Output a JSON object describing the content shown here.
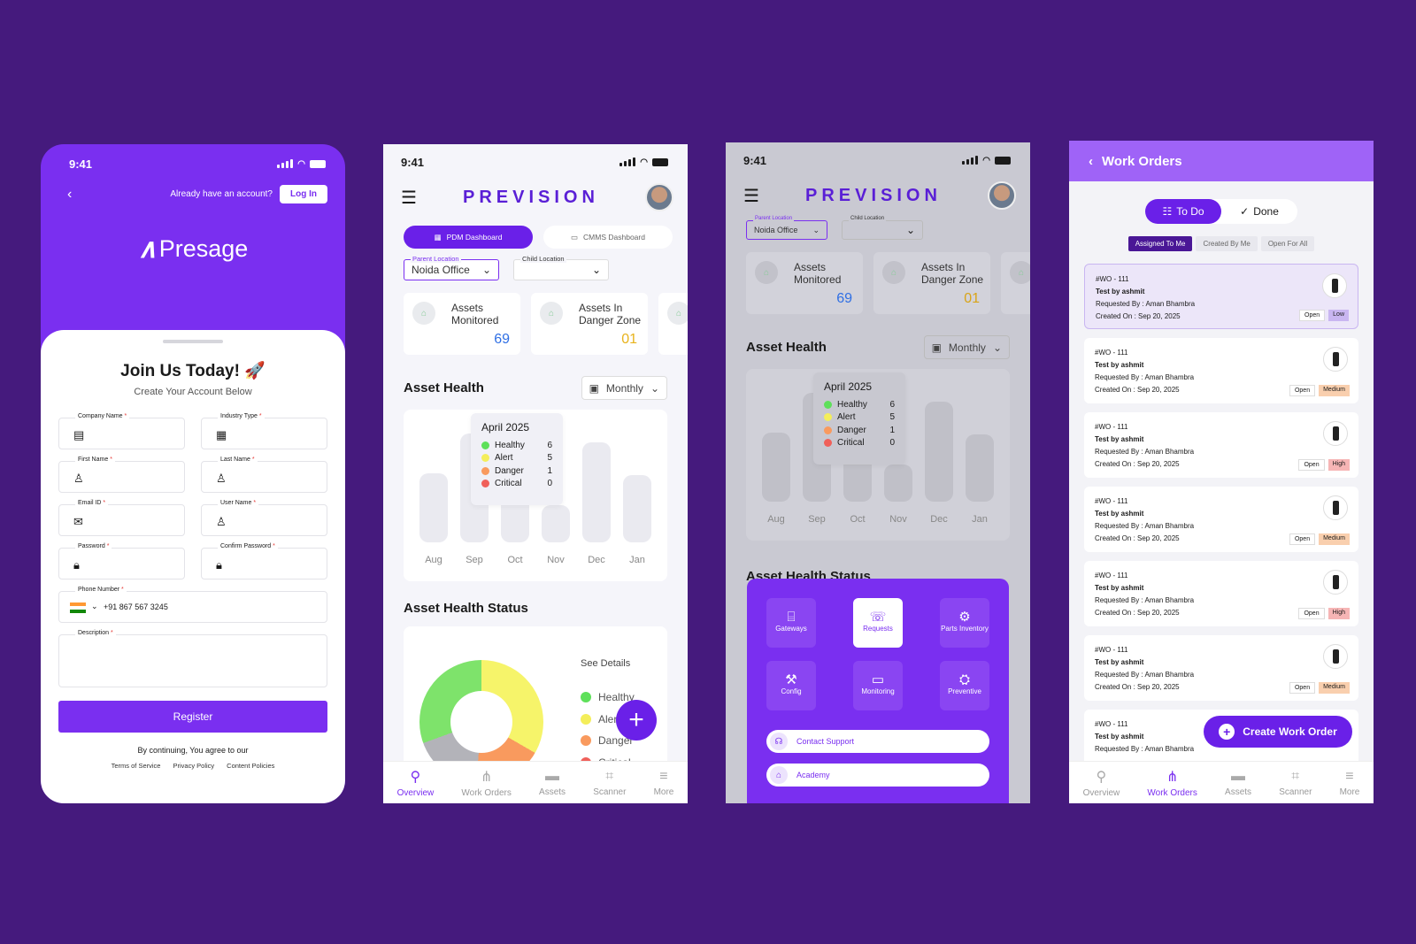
{
  "phone1": {
    "time": "9:41",
    "already_text": "Already have an account?",
    "login_label": "Log In",
    "brand": "Presage",
    "title": "Join Us Today! 🚀",
    "subtitle": "Create Your Account Below",
    "fields": {
      "company": "Company Name",
      "industry": "Industry Type",
      "first": "First Name",
      "last": "Last Name",
      "email": "Email ID",
      "username": "User Name",
      "password": "Password",
      "confirm": "Confirm Password",
      "phone": "Phone Number",
      "description": "Description"
    },
    "required_mark": "*",
    "phone_value": "+91  867 567 3245",
    "register_label": "Register",
    "terms_text": "By continuing, You agree to our",
    "links": [
      "Terms of Service",
      "Privacy Policy",
      "Content Policies"
    ]
  },
  "phone2": {
    "time": "9:41",
    "brand": "PREVISION",
    "tabs": [
      "PDM Dashboard",
      "CMMS Dashboard"
    ],
    "parent_location_label": "Parent Location",
    "parent_location_value": "Noida Office",
    "child_location_label": "Child Location",
    "cards": [
      {
        "title_1": "Assets",
        "title_2": "Monitored",
        "value": "69",
        "color": "#2f6fe4"
      },
      {
        "title_1": "Assets In",
        "title_2": "Danger Zone",
        "value": "01",
        "color": "#e8b31c"
      }
    ],
    "asset_health_title": "Asset Health",
    "period": "Monthly",
    "months": [
      "Aug",
      "Sep",
      "Oct",
      "Nov",
      "Dec",
      "Jan"
    ],
    "bar_levels": [
      0.62,
      0.98,
      0.52,
      0.33,
      0.9,
      0.6
    ],
    "tooltip": {
      "title": "April 2025",
      "rows": [
        {
          "label": "Healthy",
          "value": "6",
          "color": "#5ee05a"
        },
        {
          "label": "Alert",
          "value": "5",
          "color": "#f4ee5a"
        },
        {
          "label": "Danger",
          "value": "1",
          "color": "#f99a5e"
        },
        {
          "label": "Critical",
          "value": "0",
          "color": "#f0605a"
        }
      ]
    },
    "status_title": "Asset Health Status",
    "see_details": "See Details",
    "legend": [
      {
        "label": "Healthy",
        "color": "#5ee05a"
      },
      {
        "label": "Alert",
        "color": "#f4ee5a"
      },
      {
        "label": "Danger",
        "color": "#f99a5e"
      },
      {
        "label": "Critical",
        "color": "#f0605a"
      }
    ],
    "nav": [
      "Overview",
      "Work Orders",
      "Assets",
      "Scanner",
      "More"
    ]
  },
  "phone3": {
    "time": "9:41",
    "brand": "PREVISION",
    "parent_location_label": "Parent Location",
    "parent_location_value": "Noida Office",
    "child_location_label": "Child Location",
    "cards": [
      {
        "title_1": "Assets",
        "title_2": "Monitored",
        "value": "69",
        "color": "#2f6fe4"
      },
      {
        "title_1": "Assets In",
        "title_2": "Danger Zone",
        "value": "01",
        "color": "#d9a417"
      }
    ],
    "asset_health_title": "Asset Health",
    "period": "Monthly",
    "months": [
      "Aug",
      "Sep",
      "Oct",
      "Nov",
      "Dec",
      "Jan"
    ],
    "tooltip": {
      "title": "April 2025",
      "rows": [
        {
          "label": "Healthy",
          "value": "6"
        },
        {
          "label": "Alert",
          "value": "5"
        },
        {
          "label": "Danger",
          "value": "1"
        },
        {
          "label": "Critical",
          "value": "0"
        }
      ]
    },
    "status_title": "Asset Health Status",
    "tiles": [
      "Gateways",
      "Requests",
      "Parts Inventory",
      "Config",
      "Monitoring",
      "Preventive"
    ],
    "contact": "Contact Support",
    "academy": "Academy"
  },
  "phone4": {
    "title": "Work Orders",
    "seg": [
      "To Do",
      "Done"
    ],
    "filters": [
      "Assigned To Me",
      "Created By Me",
      "Open For All"
    ],
    "orders": [
      {
        "id": "#WO - 111",
        "title": "Test by ashmit",
        "requested": "Requested By : Aman Bhambra",
        "created": "Created On : Sep 20, 2025",
        "status": "Open",
        "priority": "Low",
        "pcolor": "#c9b6f1"
      },
      {
        "id": "#WO - 111",
        "title": "Test by ashmit",
        "requested": "Requested By : Aman Bhambra",
        "created": "Created On : Sep 20, 2025",
        "status": "Open",
        "priority": "Medium",
        "pcolor": "#f9cfae"
      },
      {
        "id": "#WO - 111",
        "title": "Test by ashmit",
        "requested": "Requested By : Aman Bhambra",
        "created": "Created On : Sep 20, 2025",
        "status": "Open",
        "priority": "High",
        "pcolor": "#f6b5b5"
      },
      {
        "id": "#WO - 111",
        "title": "Test by ashmit",
        "requested": "Requested By : Aman Bhambra",
        "created": "Created On : Sep 20, 2025",
        "status": "Open",
        "priority": "Medium",
        "pcolor": "#f9cfae"
      },
      {
        "id": "#WO - 111",
        "title": "Test by ashmit",
        "requested": "Requested By : Aman Bhambra",
        "created": "Created On : Sep 20, 2025",
        "status": "Open",
        "priority": "High",
        "pcolor": "#f6b5b5"
      },
      {
        "id": "#WO - 111",
        "title": "Test by ashmit",
        "requested": "Requested By : Aman Bhambra",
        "created": "Created On : Sep 20, 2025",
        "status": "Open",
        "priority": "Medium",
        "pcolor": "#f9cfae"
      },
      {
        "id": "#WO - 111",
        "title": "Test by ashmit",
        "requested": "Requested By : Aman Bhambra",
        "created": "",
        "status": "",
        "priority": "",
        "pcolor": ""
      }
    ],
    "create_label": "Create Work Order",
    "nav": [
      "Overview",
      "Work Orders",
      "Assets",
      "Scanner",
      "More"
    ]
  }
}
